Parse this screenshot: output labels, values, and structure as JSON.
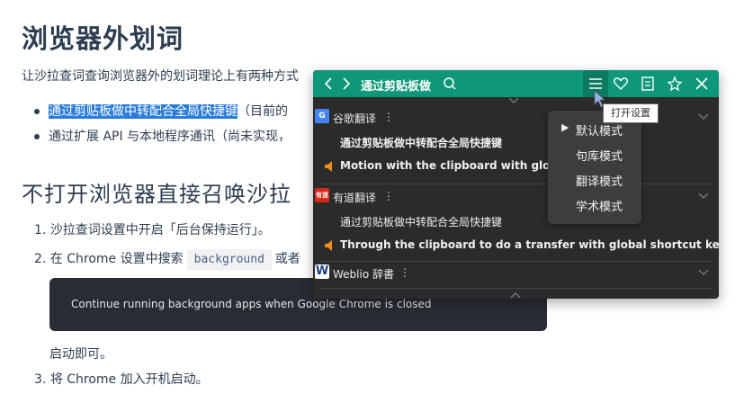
{
  "doc": {
    "title": "浏览器外划词",
    "intro": "让沙拉查词查询浏览器外的划词理论上有两种方式",
    "bullets": [
      {
        "highlight": "通过剪贴板做中转配合全局快捷键",
        "rest": "（目前的"
      },
      {
        "highlight": "",
        "rest": "通过扩展 API 与本地程序通讯（尚未实现，"
      }
    ],
    "section_title": "不打开浏览器直接召唤沙拉",
    "steps": [
      {
        "num": "1.",
        "text": "沙拉查词设置中开启「后台保持运行」。"
      },
      {
        "num": "2.",
        "pre": "在 Chrome 设置中搜索",
        "code": "background",
        "post": "或者"
      }
    ],
    "code_block": "Continue running background apps when Google Chrome is closed",
    "after_code": "启动即可。",
    "step3": {
      "num": "3.",
      "text": "将 Chrome 加入开机启动。"
    }
  },
  "panel": {
    "search_text": "通过剪贴板做",
    "sections": [
      {
        "name": "谷歌翻译",
        "logo": "G",
        "dots": "⋮",
        "rows": [
          {
            "text": "通过剪贴板做中转配合全局快捷键",
            "speaker": false,
            "bold": true
          },
          {
            "text": "Motion with the clipboard with global sho",
            "speaker": true,
            "bold": true
          }
        ]
      },
      {
        "name": "有道翻译",
        "logo": "有道",
        "dots": "⋮",
        "rows": [
          {
            "text": "通过剪贴板做中转配合全局快捷键",
            "speaker": false,
            "bold": false
          },
          {
            "text": "Through the clipboard to do a transfer with global shortcut keys",
            "speaker": true,
            "bold": true
          }
        ]
      },
      {
        "name": "Weblio 辞書",
        "logo": "W",
        "dots": "⋮",
        "rows": []
      }
    ],
    "modes": [
      {
        "label": "默认模式",
        "selected": true
      },
      {
        "label": "句库模式",
        "selected": false
      },
      {
        "label": "翻译模式",
        "selected": false
      },
      {
        "label": "学术模式",
        "selected": false
      }
    ],
    "tooltip": "打开设置",
    "colors": {
      "topbar": "#0e9778",
      "body": "#2b2b2b",
      "speaker": "#f08a1c",
      "youdao": "#d8261a",
      "google": "#4285f4",
      "weblio": "#1a3e8c"
    }
  }
}
